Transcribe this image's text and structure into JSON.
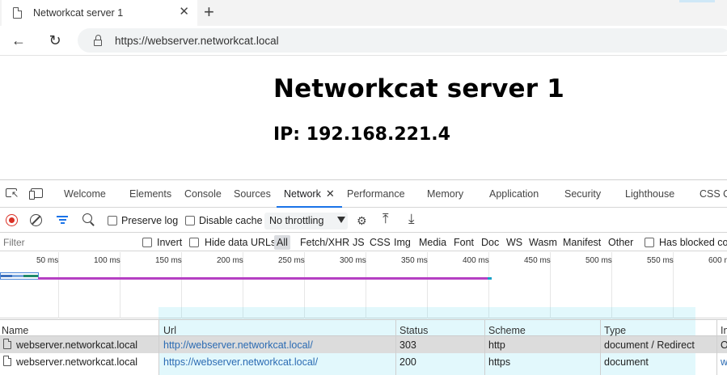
{
  "browser": {
    "tab_title": "Networkcat server 1",
    "tab_close": "✕",
    "new_tab": "+",
    "back_glyph": "←",
    "reload_glyph": "↻",
    "url": "https://webserver.networkcat.local"
  },
  "page": {
    "title": "Networkcat server 1",
    "ip_line": "IP: 192.168.221.4"
  },
  "devtools": {
    "tabs": [
      {
        "label": "Welcome",
        "active": false
      },
      {
        "label": "Elements",
        "active": false
      },
      {
        "label": "Console",
        "active": false
      },
      {
        "label": "Sources",
        "active": false
      },
      {
        "label": "Network",
        "active": true
      },
      {
        "label": "Performance",
        "active": false
      },
      {
        "label": "Memory",
        "active": false
      },
      {
        "label": "Application",
        "active": false
      },
      {
        "label": "Security",
        "active": false
      },
      {
        "label": "Lighthouse",
        "active": false
      },
      {
        "label": "CSS O",
        "active": false
      }
    ],
    "active_tab_close": "✕",
    "toolbar": {
      "preserve_log": "Preserve log",
      "disable_cache": "Disable cache",
      "throttling": "No throttling"
    },
    "filter": {
      "placeholder": "Filter",
      "invert": "Invert",
      "hide_data_urls": "Hide data URLs",
      "types": [
        "All",
        "Fetch/XHR",
        "JS",
        "CSS",
        "Img",
        "Media",
        "Font",
        "Doc",
        "WS",
        "Wasm",
        "Manifest",
        "Other"
      ],
      "has_blocked": "Has blocked coo"
    },
    "timeline": {
      "ticks": [
        "50 ms",
        "100 ms",
        "150 ms",
        "200 ms",
        "250 ms",
        "300 ms",
        "350 ms",
        "400 ms",
        "450 ms",
        "500 ms",
        "550 ms",
        "600 n"
      ]
    },
    "table": {
      "columns": [
        "Name",
        "Url",
        "Status",
        "Scheme",
        "Type",
        "In"
      ],
      "rows": [
        {
          "name": "webserver.networkcat.local",
          "url": "http://webserver.networkcat.local/",
          "status": "303",
          "scheme": "http",
          "type": "document / Redirect",
          "initiator": "O"
        },
        {
          "name": "webserver.networkcat.local",
          "url": "https://webserver.networkcat.local/",
          "status": "200",
          "scheme": "https",
          "type": "document",
          "initiator": "w"
        }
      ]
    }
  }
}
